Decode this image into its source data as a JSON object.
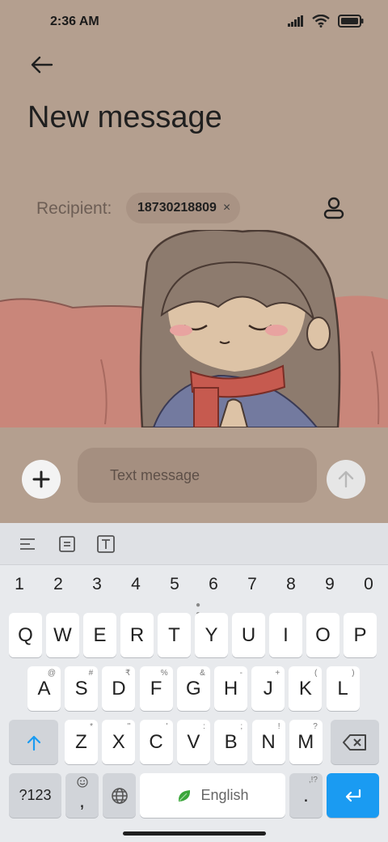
{
  "status_bar": {
    "time": "2:36 AM"
  },
  "header": {
    "title": "New message"
  },
  "recipient": {
    "label": "Recipient:",
    "chip_number": "18730218809",
    "chip_remove": "×"
  },
  "compose": {
    "placeholder": "Text message"
  },
  "keyboard": {
    "number_row": [
      "1",
      "2",
      "3",
      "4",
      "5",
      "6",
      "7",
      "8",
      "9",
      "0"
    ],
    "row1": [
      {
        "k": "Q",
        "h": ""
      },
      {
        "k": "W",
        "h": ""
      },
      {
        "k": "E",
        "h": ""
      },
      {
        "k": "R",
        "h": ""
      },
      {
        "k": "T",
        "h": ""
      },
      {
        "k": "Y",
        "h": ""
      },
      {
        "k": "U",
        "h": ""
      },
      {
        "k": "I",
        "h": ""
      },
      {
        "k": "O",
        "h": ""
      },
      {
        "k": "P",
        "h": ""
      }
    ],
    "row2": [
      {
        "k": "A",
        "h": "@"
      },
      {
        "k": "S",
        "h": "#"
      },
      {
        "k": "D",
        "h": "₹"
      },
      {
        "k": "F",
        "h": "%"
      },
      {
        "k": "G",
        "h": "&"
      },
      {
        "k": "H",
        "h": "-"
      },
      {
        "k": "J",
        "h": "+"
      },
      {
        "k": "K",
        "h": "("
      },
      {
        "k": "L",
        "h": ")"
      }
    ],
    "row3": [
      {
        "k": "Z",
        "h": "*"
      },
      {
        "k": "X",
        "h": "\""
      },
      {
        "k": "C",
        "h": "'"
      },
      {
        "k": "V",
        "h": ":"
      },
      {
        "k": "B",
        "h": ";"
      },
      {
        "k": "N",
        "h": "!"
      },
      {
        "k": "M",
        "h": "?"
      }
    ],
    "symbols_label": "?123",
    "comma_label": ",",
    "space_label": "English",
    "period_label": ".",
    "period_hint": ",!?"
  },
  "colors": {
    "background": "#b49f8f",
    "accent": "#1a9bf2",
    "leaf": "#3aa63a"
  }
}
